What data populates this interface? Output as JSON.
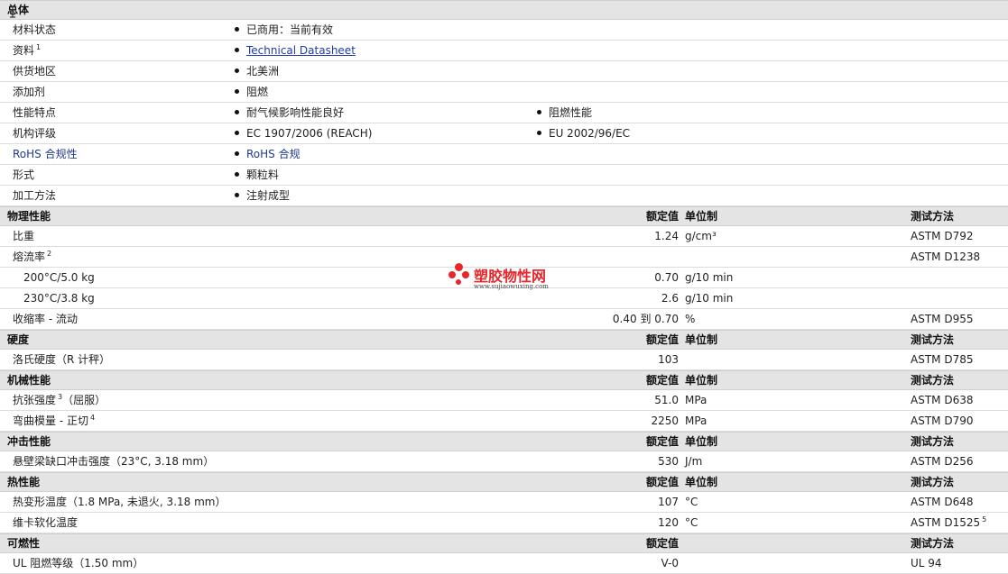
{
  "general": {
    "title": "总体",
    "rows": [
      {
        "label": "材料状态",
        "items": [
          "已商用：当前有效"
        ]
      },
      {
        "label": "资料",
        "sup": "1",
        "items": [
          "Technical Datasheet"
        ]
      },
      {
        "label": "供货地区",
        "items": [
          "北美洲"
        ]
      },
      {
        "label": "添加剂",
        "items": [
          "阻燃"
        ]
      },
      {
        "label": "性能特点",
        "items": [
          "耐气候影响性能良好",
          "阻燃性能"
        ]
      },
      {
        "label": "机构评级",
        "items": [
          "EC 1907/2006 (REACH)",
          "EU 2002/96/EC"
        ]
      },
      {
        "label": "RoHS 合规性",
        "items": [
          "RoHS 合规"
        ]
      },
      {
        "label": "形式",
        "items": [
          "颗粒料"
        ]
      },
      {
        "label": "加工方法",
        "items": [
          "注射成型"
        ]
      }
    ]
  },
  "headers": {
    "value": "额定值",
    "unit": "单位制",
    "test": "测试方法"
  },
  "physical": {
    "title": "物理性能",
    "rows": [
      {
        "label": "比重",
        "value": "1.24",
        "unit": "g/cm³",
        "test": "ASTM D792"
      },
      {
        "label": "熔流率",
        "sup": "2",
        "value": "",
        "unit": "",
        "test": "ASTM D1238"
      },
      {
        "label": "200°C/5.0 kg",
        "value": "0.70",
        "unit": "g/10 min",
        "test": ""
      },
      {
        "label": "230°C/3.8 kg",
        "value": "2.6",
        "unit": "g/10 min",
        "test": ""
      },
      {
        "label": "收缩率  - 流动",
        "value": "0.40 到  0.70",
        "unit": "%",
        "test": "ASTM D955"
      }
    ]
  },
  "hardness": {
    "title": "硬度",
    "rows": [
      {
        "label": "洛氏硬度（R 计秤）",
        "value": "103",
        "unit": "",
        "test": "ASTM D785"
      }
    ]
  },
  "mechanical": {
    "title": "机械性能",
    "rows": [
      {
        "label": "抗张强度",
        "sup": "3",
        "label_suffix": "（屈服）",
        "value": "51.0",
        "unit": "MPa",
        "test": "ASTM D638"
      },
      {
        "label": "弯曲模量  - 正切",
        "sup": "4",
        "value": "2250",
        "unit": "MPa",
        "test": "ASTM D790"
      }
    ]
  },
  "impact": {
    "title": "冲击性能",
    "rows": [
      {
        "label": "悬壁梁缺口冲击强度（23°C, 3.18 mm）",
        "value": "530",
        "unit": "J/m",
        "test": "ASTM D256"
      }
    ]
  },
  "thermal": {
    "title": "热性能",
    "rows": [
      {
        "label": "热变形温度（1.8 MPa, 未退火, 3.18 mm）",
        "value": "107",
        "unit": "°C",
        "test": "ASTM D648"
      },
      {
        "label": "维卡软化温度",
        "value": "120",
        "unit": "°C",
        "test": "ASTM D1525",
        "test_sup": "5"
      }
    ]
  },
  "flammability": {
    "title": "可燃性",
    "rows": [
      {
        "label": "UL 阻燃等级（1.50 mm）",
        "value": "V-0",
        "unit": "",
        "test": "UL 94"
      }
    ]
  },
  "watermark": {
    "name": "塑胶物性网",
    "url": "www.sujiaowuxing.com",
    "color": "#e8262b"
  }
}
